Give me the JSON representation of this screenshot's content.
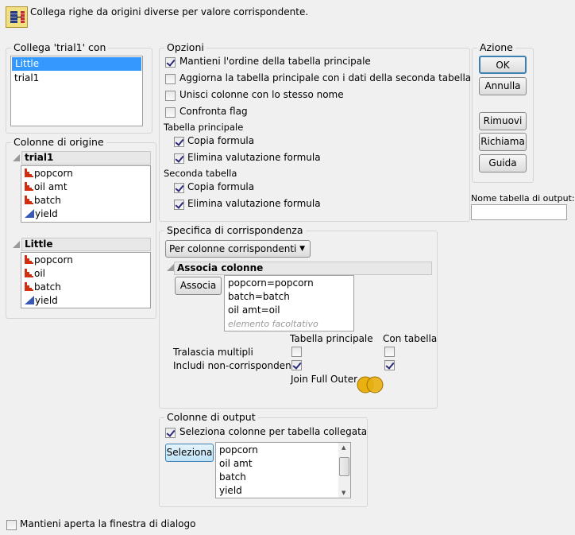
{
  "header": {
    "title": "Collega righe da origini diverse per valore corrispondente."
  },
  "join_with": {
    "legend": "Collega 'trial1' con",
    "items": [
      "Little",
      "trial1"
    ],
    "selected": "Little"
  },
  "source_columns": {
    "legend": "Colonne di origine",
    "tables": [
      {
        "name": "trial1",
        "columns": [
          {
            "name": "popcorn",
            "type": "nominal"
          },
          {
            "name": "oil amt",
            "type": "nominal"
          },
          {
            "name": "batch",
            "type": "nominal"
          },
          {
            "name": "yield",
            "type": "continuous"
          }
        ]
      },
      {
        "name": "Little",
        "columns": [
          {
            "name": "popcorn",
            "type": "nominal"
          },
          {
            "name": "oil",
            "type": "nominal"
          },
          {
            "name": "batch",
            "type": "nominal"
          },
          {
            "name": "yield",
            "type": "continuous"
          }
        ]
      }
    ]
  },
  "options": {
    "legend": "Opzioni",
    "items": [
      {
        "label": "Mantieni l'ordine della tabella principale",
        "checked": true
      },
      {
        "label": "Aggiorna la tabella principale con i dati della seconda tabella",
        "checked": false
      },
      {
        "label": "Unisci colonne con lo stesso nome",
        "checked": false
      },
      {
        "label": "Confronta flag",
        "checked": false
      }
    ],
    "main_table_label": "Tabella principale",
    "main_table": [
      {
        "label": "Copia formula",
        "checked": true
      },
      {
        "label": "Elimina valutazione formula",
        "checked": true
      }
    ],
    "second_table_label": "Seconda tabella",
    "second_table": [
      {
        "label": "Copia formula",
        "checked": true
      },
      {
        "label": "Elimina valutazione formula",
        "checked": true
      }
    ]
  },
  "action": {
    "legend": "Azione",
    "ok": "OK",
    "cancel": "Annulla",
    "remove": "Rimuovi",
    "recall": "Richiama",
    "help": "Guida"
  },
  "output_name": {
    "label": "Nome tabella di output:",
    "value": ""
  },
  "matching": {
    "legend": "Specifica di corrispondenza",
    "method": "Per colonne corrispondenti",
    "match_columns_header": "Associa colonne",
    "match_button": "Associa",
    "pairs": [
      "popcorn=popcorn",
      "batch=batch",
      "oil amt=oil"
    ],
    "optional_placeholder": "elemento facoltativo",
    "col_main": "Tabella principale",
    "col_with": "Con tabella",
    "drop_multiples": {
      "label": "Tralascia multipli",
      "main": false,
      "with": false
    },
    "include_nonmatches": {
      "label": "Includi non-corrispondenze",
      "main": true,
      "with": true
    },
    "join_type": "Join Full Outer"
  },
  "output_columns": {
    "legend": "Colonne di output",
    "select_label": "Seleziona colonne per tabella collegata",
    "select_checked": true,
    "select_button": "Seleziona",
    "columns": [
      "popcorn",
      "oil amt",
      "batch",
      "yield"
    ]
  },
  "keep_open": {
    "label": "Mantieni aperta la finestra di dialogo",
    "checked": false
  }
}
